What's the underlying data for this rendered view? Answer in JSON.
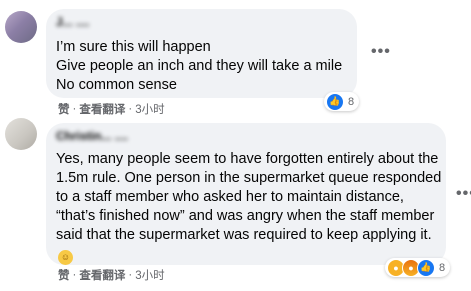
{
  "comments": [
    {
      "author": "J... ....",
      "text": "I’m sure this will happen\nGive people an inch and they will take a mile\nNo common sense",
      "reaction_count": "8",
      "actions": {
        "like": "赞",
        "translate": "查看翻译",
        "time": "3小时"
      }
    },
    {
      "author": "Christin... ....",
      "text": "Yes, many people seem to have forgotten entirely about the 1.5m rule. One person in the supermarket queue responded to a staff member who asked her to maintain distance, “that’s finished now” and was angry when the staff member said that the supermarket was required to keep applying it.",
      "reaction_count": "8",
      "actions": {
        "like": "赞",
        "translate": "查看翻译",
        "time": "3小时"
      }
    }
  ],
  "ui": {
    "separator": "·",
    "more_glyph": "•••"
  },
  "colors": {
    "bubble": "#f0f2f5",
    "secondary_text": "#65676b",
    "like_blue": "#1877f2"
  },
  "icons": [
    "avatar",
    "like-reaction-icon",
    "wow-reaction-icon",
    "angry-reaction-icon",
    "more-options-icon",
    "relieved-face-emoji"
  ]
}
